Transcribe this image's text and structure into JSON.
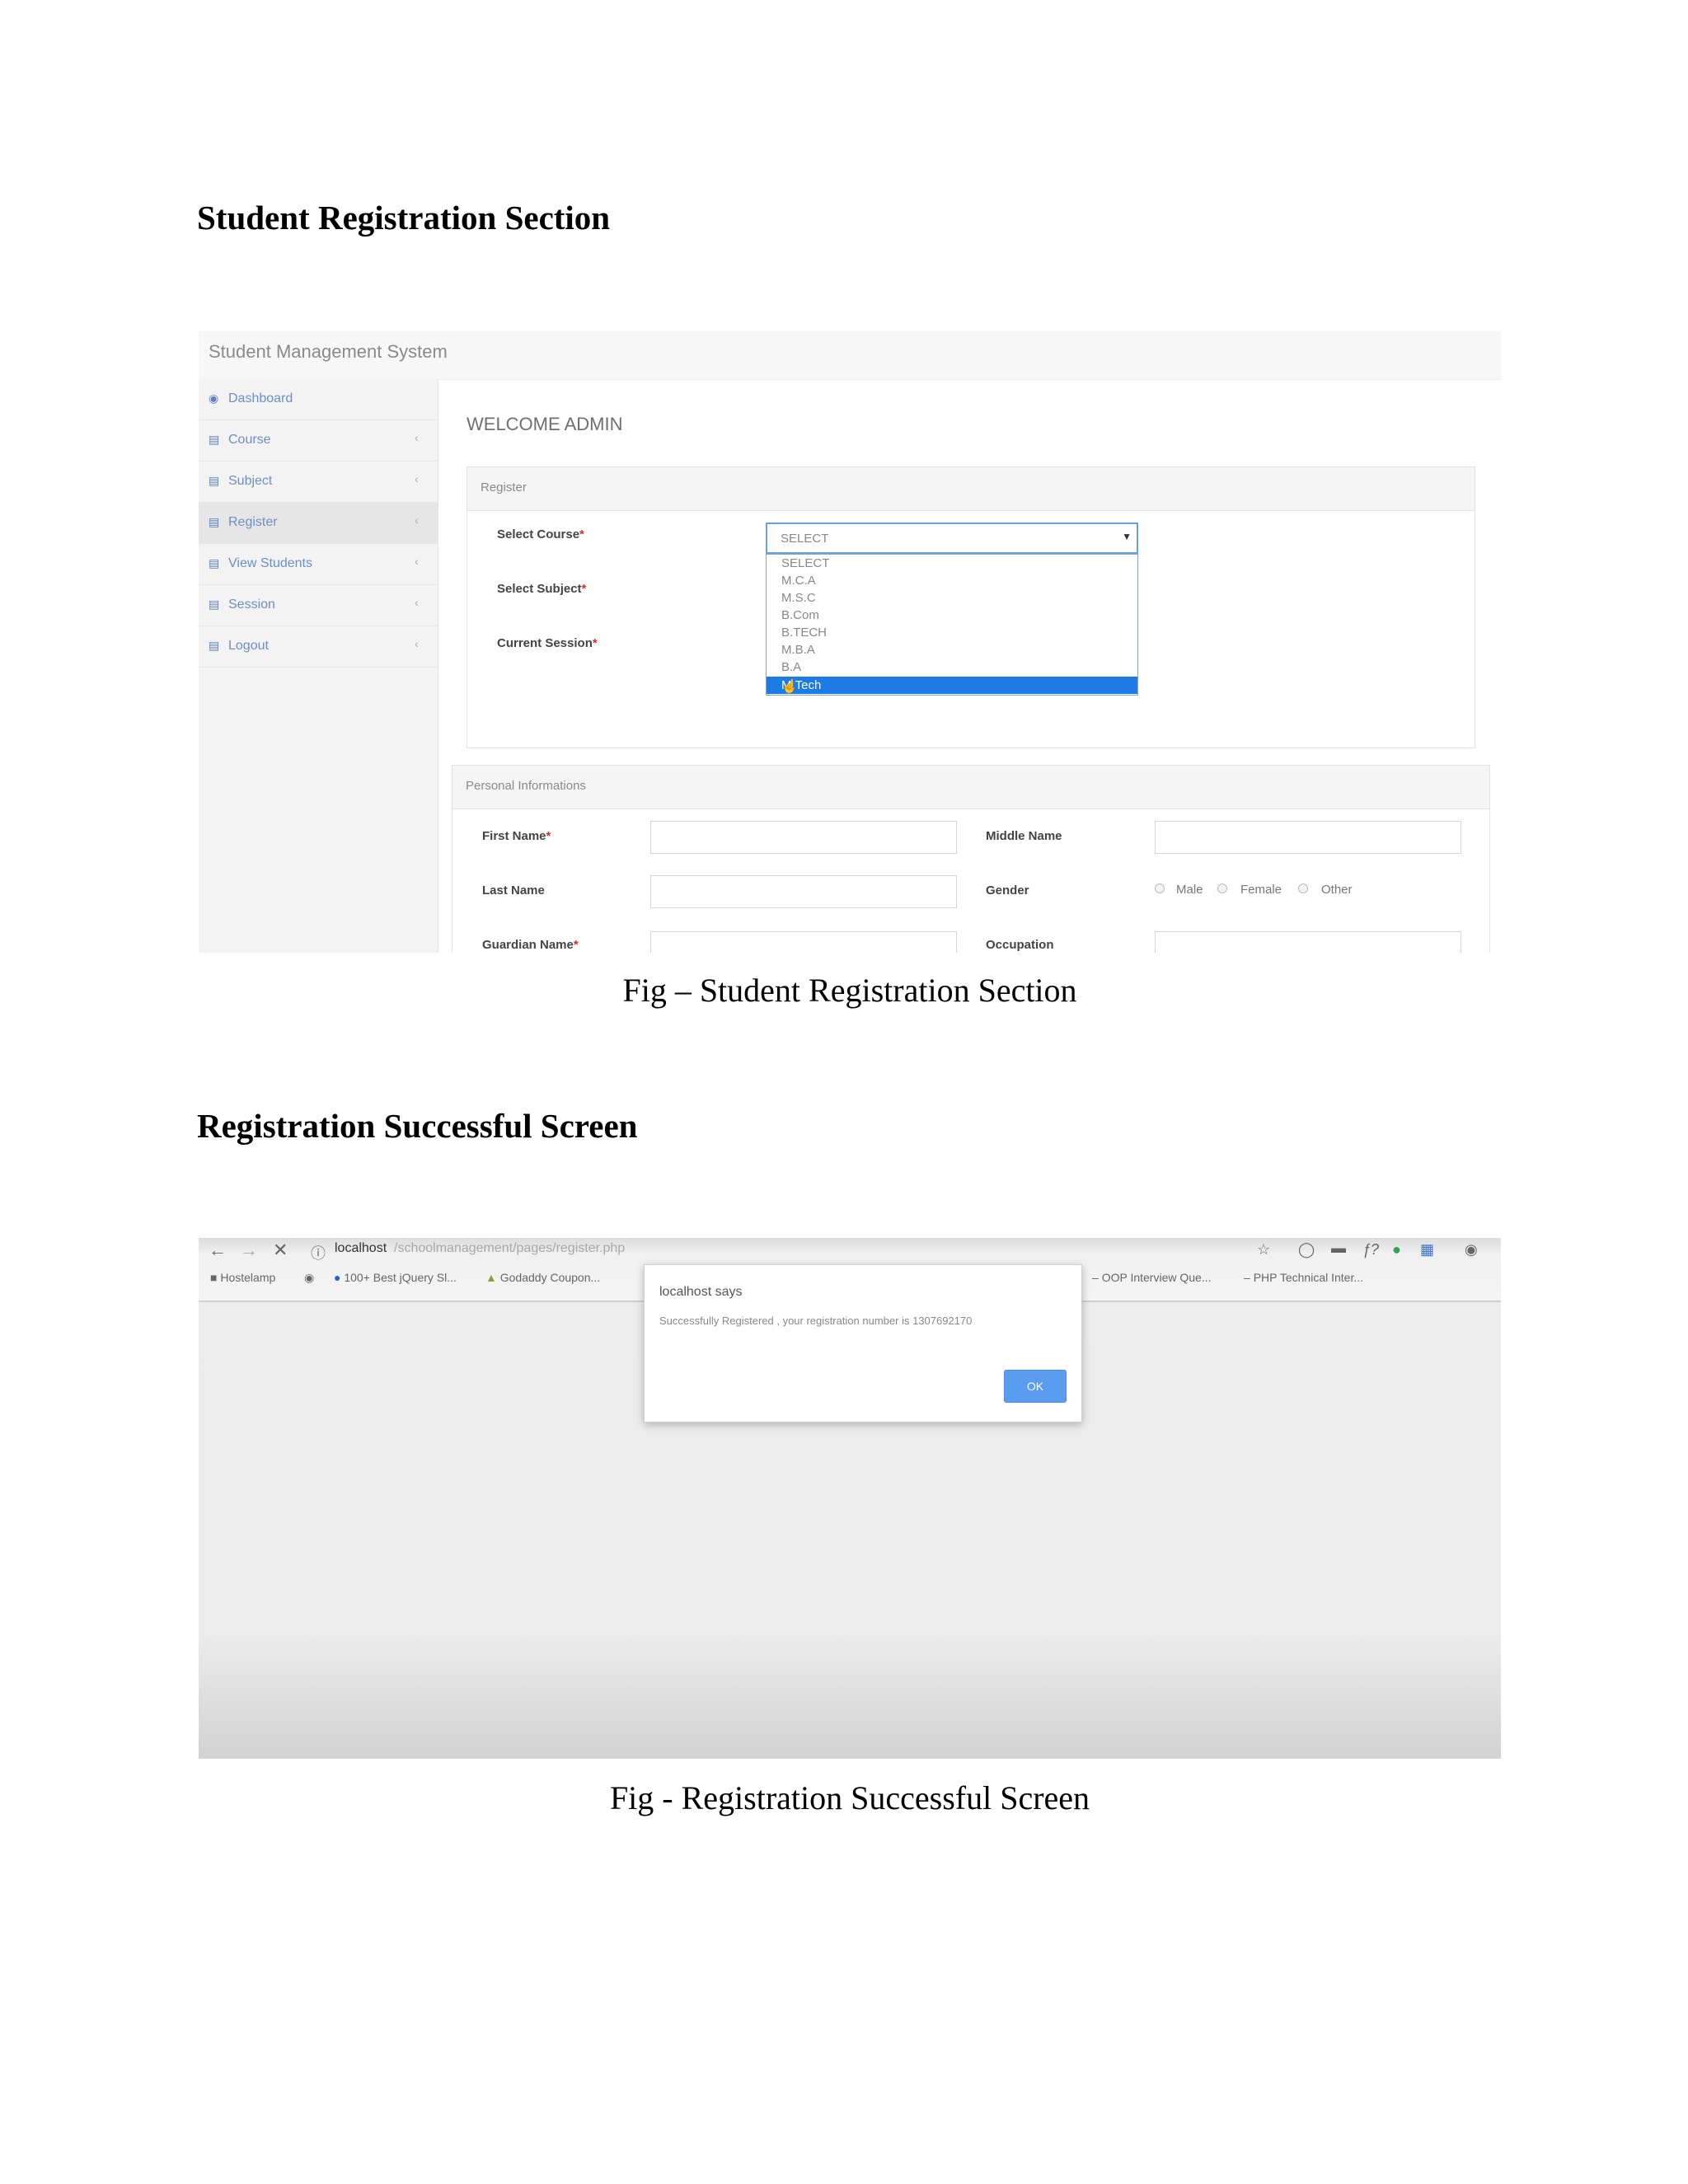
{
  "section1": {
    "heading": "Student Registration Section",
    "caption": "Fig – Student Registration Section",
    "app": {
      "title": "Student Management System",
      "sidebar": [
        {
          "icon": "dashboard-icon",
          "label": "Dashboard"
        },
        {
          "icon": "bar-chart-icon",
          "label": "Course"
        },
        {
          "icon": "bar-chart-icon",
          "label": "Subject"
        },
        {
          "icon": "bar-chart-icon",
          "label": "Register"
        },
        {
          "icon": "bar-chart-icon",
          "label": "View Students"
        },
        {
          "icon": "bar-chart-icon",
          "label": "Session"
        },
        {
          "icon": "bar-chart-icon",
          "label": "Logout"
        }
      ],
      "welcome": "WELCOME ADMIN",
      "register_panel": {
        "title": "Register",
        "select_course_label": "Select Course",
        "select_subject_label": "Select Subject",
        "current_session_label": "Current Session",
        "course_selected": "SELECT",
        "course_options": [
          "SELECT",
          "M.C.A",
          "M.S.C",
          "B.Com",
          "B.TECH",
          "M.B.A",
          "B.A",
          "M.Tech"
        ],
        "highlighted_option": "M.Tech"
      },
      "personal_panel": {
        "title": "Personal Informations",
        "first_name_label": "First Name",
        "middle_name_label": "Middle Name",
        "last_name_label": "Last Name",
        "gender_label": "Gender",
        "gender_options": [
          "Male",
          "Female",
          "Other"
        ],
        "guardian_name_label": "Guardian Name",
        "occupation_label": "Occupation"
      }
    }
  },
  "section2": {
    "heading": "Registration Successful Screen",
    "caption": "Fig - Registration Successful Screen",
    "browser": {
      "address_host": "localhost",
      "address_path": "/schoolmanagement/pages/register.php",
      "bookmarks": [
        "Hostelamp",
        "100+ Best jQuery Sl...",
        "Godaddy Coupon...",
        "OOP Interview Que...",
        "PHP Technical Inter..."
      ]
    },
    "dialog": {
      "title": "localhost says",
      "message": "Successfully Registered , your registration number is 1307692170",
      "ok_label": "OK"
    }
  },
  "colors": {
    "accent": "#1e7be6",
    "ok_button": "#5a9cf0",
    "sidebar_link": "#6b8fc6"
  }
}
